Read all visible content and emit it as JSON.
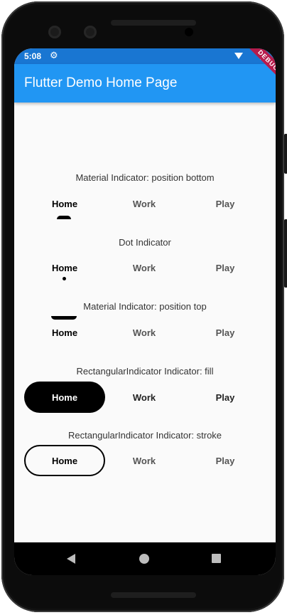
{
  "status": {
    "time": "5:08",
    "gear_icon": "⚙"
  },
  "appbar": {
    "title": "Flutter Demo Home Page",
    "debug_banner": "DEBUG"
  },
  "sections": [
    {
      "label": "Material Indicator: position bottom",
      "tabs": [
        "Home",
        "Work",
        "Play"
      ],
      "selected": "Home"
    },
    {
      "label": "Dot Indicator",
      "tabs": [
        "Home",
        "Work",
        "Play"
      ],
      "selected": "Home"
    },
    {
      "label": "Material Indicator: position top",
      "tabs": [
        "Home",
        "Work",
        "Play"
      ],
      "selected": "Home"
    },
    {
      "label": "RectangularIndicator Indicator: fill",
      "tabs": [
        "Home",
        "Work",
        "Play"
      ],
      "selected": "Home"
    },
    {
      "label": "RectangularIndicator Indicator: stroke",
      "tabs": [
        "Home",
        "Work",
        "Play"
      ],
      "selected": "Home"
    }
  ],
  "colors": {
    "appbar": "#2196f3",
    "statusbar": "#1976d2",
    "debug": "#b71c4c"
  }
}
